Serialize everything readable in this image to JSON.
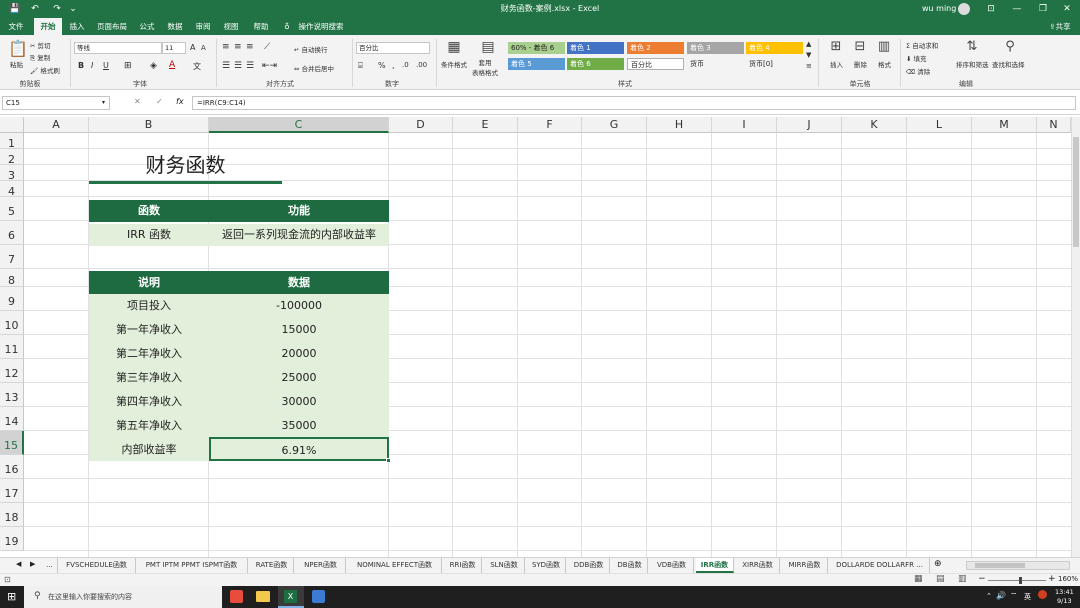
{
  "titlebar": {
    "title": "财务函数-案例.xlsx  -  Excel",
    "user": "wu ming"
  },
  "menu": [
    "文件",
    "开始",
    "插入",
    "页面布局",
    "公式",
    "数据",
    "审阅",
    "视图",
    "帮助",
    "操作说明搜索"
  ],
  "share_label": "共享",
  "ribbon": {
    "clipboard": {
      "paste": "粘贴",
      "cut": "剪切",
      "copy": "复制",
      "format_painter": "格式刷",
      "label": "剪贴板"
    },
    "font": {
      "name": "等线",
      "size": "11",
      "bold": "B",
      "italic": "I",
      "underline": "U",
      "label": "字体"
    },
    "alignment": {
      "wrap": "自动换行",
      "merge": "合并后居中",
      "label": "对齐方式"
    },
    "number": {
      "format": "百分比",
      "label": "数字"
    },
    "styles": {
      "conditional": "条件格式",
      "table": "套用\n表格格式",
      "cells": [
        {
          "label": "60% - 着色 6",
          "bg": "#a9d08e"
        },
        {
          "label": "着色 1",
          "bg": "#4472c4"
        },
        {
          "label": "着色 2",
          "bg": "#ed7d31"
        },
        {
          "label": "着色 3",
          "bg": "#a5a5a5"
        },
        {
          "label": "着色 4",
          "bg": "#ffc000"
        },
        {
          "label": "着色 5",
          "bg": "#5b9bd5"
        },
        {
          "label": "着色 6",
          "bg": "#70ad47"
        },
        {
          "label": "百分比",
          "bg": "#ffffff"
        },
        {
          "label": "货币",
          "bg": "#f3f3f3"
        },
        {
          "label": "货币[0]",
          "bg": "#f3f3f3"
        }
      ],
      "label": "样式"
    },
    "cells_group": {
      "insert": "插入",
      "delete": "删除",
      "format": "格式",
      "label": "单元格"
    },
    "editing": {
      "autosum": "自动求和",
      "fill": "填充",
      "clear": "清除",
      "sort": "排序和筛选",
      "find": "查找和选择",
      "label": "编辑"
    }
  },
  "formula_bar": {
    "name_box": "C15",
    "fx": "fx",
    "formula": "=IRR(C9:C14)"
  },
  "columns": [
    "A",
    "B",
    "C",
    "D",
    "E",
    "F",
    "G",
    "H",
    "I",
    "J",
    "K",
    "L",
    "M",
    "N"
  ],
  "rows": [
    "1",
    "2",
    "3",
    "4",
    "5",
    "6",
    "7",
    "8",
    "9",
    "10",
    "11",
    "12",
    "13",
    "14",
    "15",
    "16",
    "17",
    "18",
    "19"
  ],
  "cells": {
    "title": "财务函数",
    "hdr_func": "函数",
    "hdr_feature": "功能",
    "func_name": "IRR 函数",
    "func_desc": "返回一系列现金流的内部收益率",
    "hdr_desc": "说明",
    "hdr_data": "数据",
    "data_rows": [
      {
        "label": "项目投入",
        "value": "-100000"
      },
      {
        "label": "第一年净收入",
        "value": "15000"
      },
      {
        "label": "第二年净收入",
        "value": "20000"
      },
      {
        "label": "第三年净收入",
        "value": "25000"
      },
      {
        "label": "第四年净收入",
        "value": "30000"
      },
      {
        "label": "第五年净收入",
        "value": "35000"
      }
    ],
    "result_label": "内部收益率",
    "result_value": "6.91%"
  },
  "sheet_tabs": [
    "...",
    "FVSCHEDULE函数",
    "PMT IPTM PPMT ISPMT函数",
    "RATE函数",
    "NPER函数",
    "NOMINAL EFFECT函数",
    "RRI函数",
    "SLN函数",
    "SYD函数",
    "DDB函数",
    "DB函数",
    "VDB函数",
    "IRR函数",
    "XIRR函数",
    "MIRR函数",
    "DOLLARDE DOLLARFR ..."
  ],
  "active_tab": "IRR函数",
  "status": {
    "zoom": "160%"
  },
  "taskbar": {
    "search": "在这里输入你要搜索的内容",
    "time": "13:41",
    "date": "9/13",
    "lang": "英"
  },
  "colors": {
    "excel_green": "#217346",
    "header_dark_green": "#1e6b41",
    "table_light_green": "#e2efda"
  }
}
